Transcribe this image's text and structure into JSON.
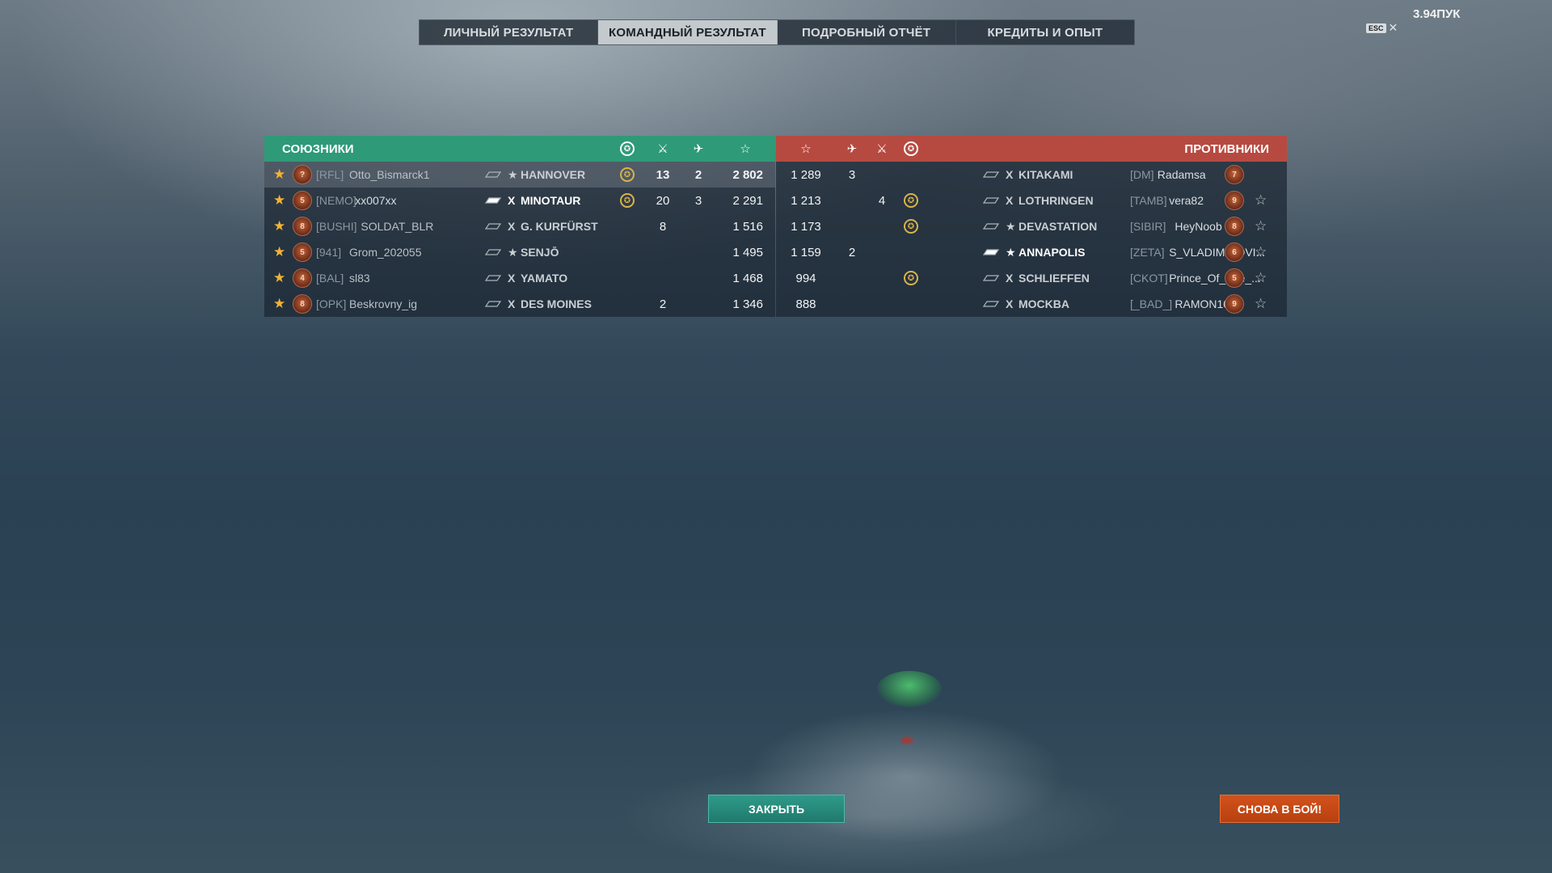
{
  "tabs": [
    {
      "label": "ЛИЧНЫЙ РЕЗУЛЬТАТ",
      "active": false
    },
    {
      "label": "КОМАНДНЫЙ РЕЗУЛЬТАТ",
      "active": true
    },
    {
      "label": "ПОДРОБНЫЙ ОТЧЁТ",
      "active": false
    },
    {
      "label": "КРЕДИТЫ И ОПЫТ",
      "active": false
    }
  ],
  "fps": "3.94ПУК",
  "esc_label": "ESC",
  "allies": {
    "title": "СОЮЗНИКИ",
    "color": "#2e9a78",
    "rows": [
      {
        "clan": "[RFL]",
        "nick": "Otto_Bismarck1",
        "rank": "?",
        "tier": "★",
        "ship": "HANNOVER",
        "wreath": true,
        "kills": "13",
        "planes": "2",
        "xp": "2 802",
        "highlight": true,
        "bold_stats": true
      },
      {
        "clan": "[NEMO]",
        "nick": "xx007xx",
        "rank": "5",
        "tier": "X",
        "ship": "MINOTAUR",
        "wreath": true,
        "kills": "20",
        "planes": "3",
        "xp": "2 291",
        "highlight": false,
        "bold_stats": false
      },
      {
        "clan": "[BUSHI]",
        "nick": "SOLDAT_BLR",
        "rank": "8",
        "tier": "X",
        "ship": "G. KURFÜRST",
        "wreath": false,
        "kills": "8",
        "planes": "",
        "xp": "1 516",
        "highlight": false,
        "bold_stats": false
      },
      {
        "clan": "[941]",
        "nick": "Grom_202055",
        "rank": "5",
        "tier": "★",
        "ship": "SENJŌ",
        "wreath": false,
        "kills": "",
        "planes": "",
        "xp": "1 495",
        "highlight": false,
        "bold_stats": false
      },
      {
        "clan": "[BAL]",
        "nick": "sl83",
        "rank": "4",
        "tier": "X",
        "ship": "YAMATO",
        "wreath": false,
        "kills": "",
        "planes": "",
        "xp": "1 468",
        "highlight": false,
        "bold_stats": false
      },
      {
        "clan": "[OPK]",
        "nick": "Beskrovny_ig",
        "rank": "8",
        "tier": "X",
        "ship": "DES MOINES",
        "wreath": false,
        "kills": "2",
        "planes": "",
        "xp": "1 346",
        "highlight": false,
        "bold_stats": false
      }
    ]
  },
  "enemies": {
    "title": "ПРОТИВНИКИ",
    "color": "#b64a40",
    "rows": [
      {
        "xp": "1 289",
        "planes": "3",
        "kills": "",
        "wreath": false,
        "tier": "X",
        "ship": "KITAKAMI",
        "clan": "[DM]",
        "nick": "Radamsa",
        "rank": "7",
        "star": false
      },
      {
        "xp": "1 213",
        "planes": "",
        "kills": "4",
        "wreath": true,
        "tier": "X",
        "ship": "LOTHRINGEN",
        "clan": "[TAMB]",
        "nick": "vera82",
        "rank": "9",
        "star": true
      },
      {
        "xp": "1 173",
        "planes": "",
        "kills": "",
        "wreath": true,
        "tier": "★",
        "ship": "DEVASTATION",
        "clan": "[SIBIR]",
        "nick": "HeyNoob",
        "rank": "8",
        "star": true
      },
      {
        "xp": "1 159",
        "planes": "2",
        "kills": "",
        "wreath": false,
        "tier": "★",
        "ship": "ANNAPOLIS",
        "clan": "[ZETA]",
        "nick": "S_VLADIMIROVI...",
        "rank": "6",
        "star": true
      },
      {
        "xp": "994",
        "planes": "",
        "kills": "",
        "wreath": true,
        "tier": "X",
        "ship": "SCHLIEFFEN",
        "clan": "[CKOT]",
        "nick": "Prince_Of_The_...",
        "rank": "5",
        "star": true
      },
      {
        "xp": "888",
        "planes": "",
        "kills": "",
        "wreath": false,
        "tier": "X",
        "ship": "MOCKBA",
        "clan": "[_BAD_]",
        "nick": "RAMON101",
        "rank": "9",
        "star": true
      }
    ]
  },
  "buttons": {
    "close": "ЗАКРЫТЬ",
    "battle": "СНОВА В БОЙ!"
  },
  "icons": {
    "wreath": "wreath-icon",
    "kills": "crossed-swords-icon",
    "planes": "plane-icon",
    "xp": "star-icon"
  }
}
